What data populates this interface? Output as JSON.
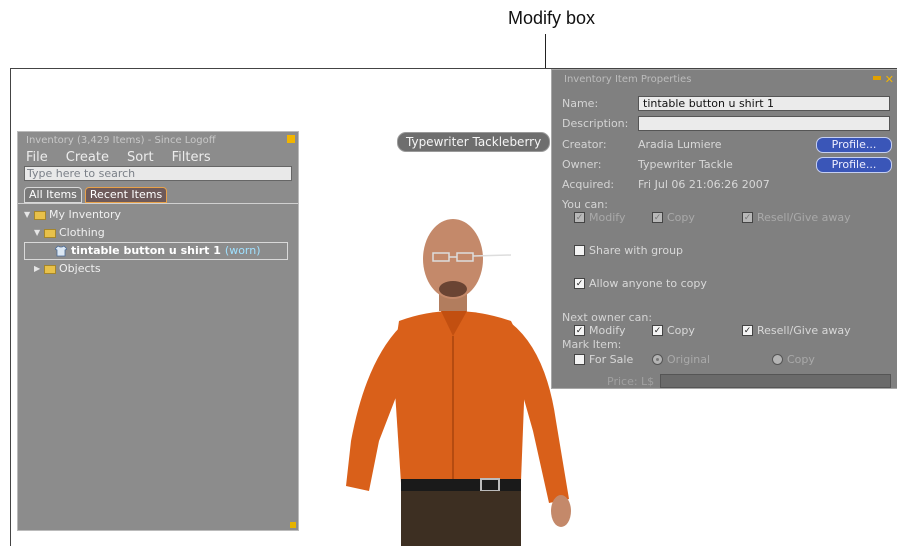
{
  "callout": {
    "label": "Modify box"
  },
  "inventory": {
    "title": "Inventory (3,429 Items) - Since Logoff",
    "menu": [
      "File",
      "Create",
      "Sort",
      "Filters"
    ],
    "search_placeholder": "Type here to search",
    "tabs": [
      "All Items",
      "Recent Items"
    ],
    "tree": {
      "root": "My Inventory",
      "folder1": "Clothing",
      "item": "tintable button u shirt 1",
      "item_status": "(worn)",
      "folder2": "Objects"
    }
  },
  "avatar": {
    "nametag": "Typewriter Tackleberry"
  },
  "properties": {
    "title": "Inventory Item Properties",
    "name_label": "Name:",
    "name_value": "tintable button u shirt 1",
    "description_label": "Description:",
    "description_value": "",
    "creator_label": "Creator:",
    "creator_value": "Aradia Lumiere",
    "owner_label": "Owner:",
    "owner_value": "Typewriter Tackle",
    "profile_button": "Profile...",
    "acquired_label": "Acquired:",
    "acquired_value": "Fri Jul 06 21:06:26 2007",
    "you_can_label": "You can:",
    "you_can": {
      "modify": "Modify",
      "copy": "Copy",
      "resell": "Resell/Give away"
    },
    "share_with_group": "Share with group",
    "allow_anyone_copy": "Allow anyone to copy",
    "next_owner_label": "Next owner can:",
    "next_owner": {
      "modify": "Modify",
      "copy": "Copy",
      "resell": "Resell/Give away"
    },
    "mark_item_label": "Mark Item:",
    "for_sale": "For Sale",
    "original": "Original",
    "copy_option": "Copy",
    "price_label": "Price: L$"
  },
  "colors": {
    "panel_bg": "#808080",
    "profile_button": "#3a56b8",
    "shirt": "#d9601a",
    "title_accent": "#f2b500"
  }
}
